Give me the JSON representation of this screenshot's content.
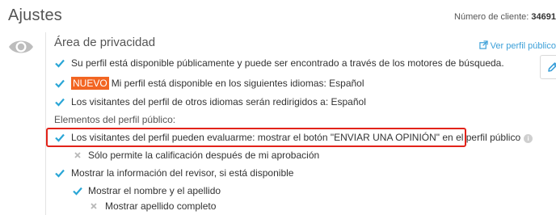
{
  "header": {
    "title": "Ajustes",
    "client_label": "Número de cliente:",
    "client_number": "34691"
  },
  "privacy": {
    "icon": "eye-icon",
    "title": "Área de privacidad",
    "view_profile_link": "Ver perfil público",
    "edit_icon": "pencil-icon",
    "items": [
      {
        "text": "Su perfil está disponible públicamente y puede ser encontrado a través de los motores de búsqueda.",
        "state": "checked"
      },
      {
        "badge": "NUEVO",
        "text": "Mi perfil está disponible en los siguientes idiomas: Español",
        "state": "checked"
      },
      {
        "text": "Los visitantes del perfil de otros idiomas serán redirigidos a: Español",
        "state": "checked"
      }
    ],
    "public_elements_label": "Elementos del perfil público:",
    "public_elements": [
      {
        "text": "Los visitantes del perfil pueden evaluarme: mostrar el botón \"ENVIAR UNA OPINIÓN\" en el perfil público",
        "state": "checked",
        "info": "i"
      },
      {
        "text": "Sólo permite la calificación después de mi aprobación",
        "state": "unchecked"
      },
      {
        "text": "Mostrar la información del revisor, si está disponible",
        "state": "checked"
      },
      {
        "text": "Mostrar el nombre y el apellido",
        "state": "checked"
      },
      {
        "text": "Mostrar apellido completo",
        "state": "unchecked"
      }
    ]
  },
  "colors": {
    "check": "#2aa6d6",
    "cross": "#b8b8b8",
    "badge": "#f26522",
    "link": "#3b9fd8",
    "highlight": "#e2231a"
  }
}
